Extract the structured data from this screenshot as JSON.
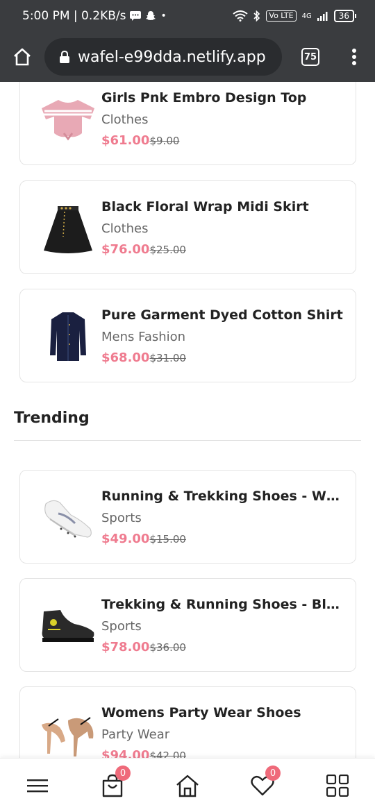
{
  "status_bar": {
    "time_speed": "5:00 PM | 0.2KB/s",
    "volte": "Vo LTE",
    "network": "4G",
    "battery": "36"
  },
  "browser": {
    "url": "wafel-e99dda.netlify.app",
    "tab_count": "75"
  },
  "products_top": [
    {
      "name": "Girls Pnk Embro Design Top",
      "category": "Clothes",
      "price": "$61.00",
      "old_price": "$9.00",
      "icon": "pink-top-image"
    },
    {
      "name": "Black Floral Wrap Midi Skirt",
      "category": "Clothes",
      "price": "$76.00",
      "old_price": "$25.00",
      "icon": "black-skirt-image"
    },
    {
      "name": "Pure Garment Dyed Cotton Shirt",
      "category": "Mens Fashion",
      "price": "$68.00",
      "old_price": "$31.00",
      "icon": "navy-shirt-image"
    }
  ],
  "trending": {
    "title": "Trending",
    "products": [
      {
        "name": "Running & Trekking Shoes - Wh...",
        "category": "Sports",
        "price": "$49.00",
        "old_price": "$15.00",
        "icon": "white-shoe-image"
      },
      {
        "name": "Trekking & Running Shoes - Bla...",
        "category": "Sports",
        "price": "$78.00",
        "old_price": "$36.00",
        "icon": "black-shoe-image"
      },
      {
        "name": "Womens Party Wear Shoes",
        "category": "Party Wear",
        "price": "$94.00",
        "old_price": "$42.00",
        "icon": "heels-image"
      }
    ]
  },
  "bottom_nav": {
    "cart_count": "0",
    "wishlist_count": "0"
  },
  "colors": {
    "accent": "#ef7b8f",
    "badge": "#ef6a7a",
    "chrome": "#3a3c3f"
  }
}
